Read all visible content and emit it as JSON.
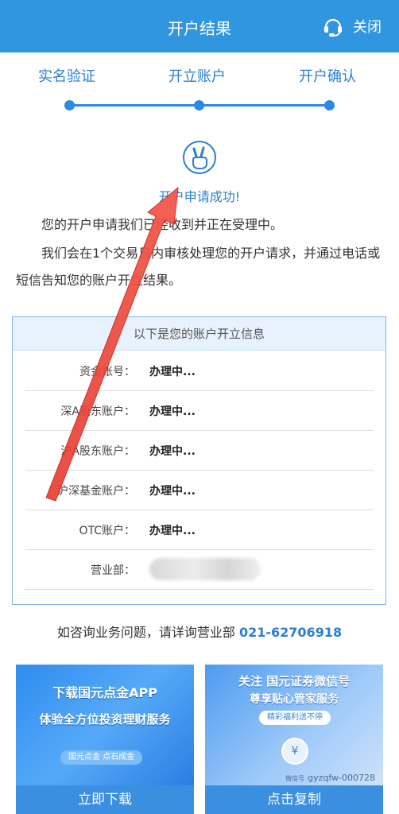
{
  "header": {
    "title": "开户结果",
    "close_label": "关闭"
  },
  "steps": [
    {
      "label": "实名验证"
    },
    {
      "label": "开立账户"
    },
    {
      "label": "开户确认"
    }
  ],
  "result": {
    "success_text": "开户申请成功!",
    "para1": "您的开户申请我们已经收到并正在受理中。",
    "para2": "我们会在1个交易日内审核处理您的开户请求，并通过电话或短信告知您的账户开立结果。"
  },
  "info": {
    "heading": "以下是您的账户开立信息",
    "rows": [
      {
        "label": "资金账号：",
        "value": "办理中..."
      },
      {
        "label": "深A股东账户：",
        "value": "办理中..."
      },
      {
        "label": "沪A股东账户：",
        "value": "办理中..."
      },
      {
        "label": "沪深基金账户：",
        "value": "办理中..."
      },
      {
        "label": "OTC账户：",
        "value": "办理中..."
      },
      {
        "label": "营业部：",
        "value": ""
      }
    ]
  },
  "consult": {
    "text": "如咨询业务问题，请详询营业部 ",
    "phone": "021-62706918"
  },
  "cards": {
    "download": {
      "line1": "下载国元点金APP",
      "line2": "体验全方位投资理财服务",
      "tag": "国元点金 点石成金",
      "button": "立即下载"
    },
    "wechat": {
      "line1": "关注 国元证券微信号",
      "line2": "尊享贴心管家服务",
      "tag": "精彩福利送不停",
      "wx_label": "微信号",
      "wx_id": "gyzqfw-000728",
      "button": "点击复制"
    }
  },
  "colors": {
    "header": "#3196e0",
    "accent": "#2a7fd4",
    "annotation_arrow": "#e63b2e"
  }
}
